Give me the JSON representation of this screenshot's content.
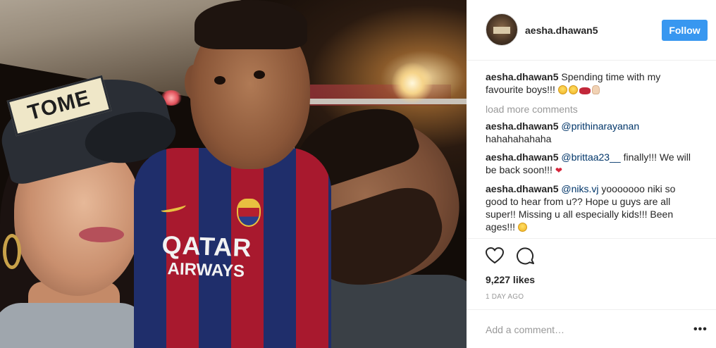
{
  "post": {
    "author": "aesha.dhawan5",
    "follow_label": "Follow",
    "caption": {
      "username": "aesha.dhawan5",
      "text": "Spending time with my favourite boys!!!",
      "emojis": [
        "smiling-face",
        "smiling-face",
        "kiss-mark",
        "hand"
      ]
    },
    "load_more_label": "load more comments",
    "comments": [
      {
        "username": "aesha.dhawan5",
        "mention": "@prithinarayanan",
        "text": "hahahahahaha"
      },
      {
        "username": "aesha.dhawan5",
        "mention": "@brittaa23__",
        "text": "finally!!! We will be back soon!!!",
        "emoji": "red-heart"
      },
      {
        "username": "aesha.dhawan5",
        "mention": "@niks.vj",
        "text": "yooooooo niki so good to hear from u?? Hope u guys are all super!! Missing u all especially kids!!! Been ages!!!",
        "emoji": "smiling-face"
      }
    ],
    "likes": "9,227 likes",
    "timestamp": "1 DAY AGO",
    "add_comment_placeholder": "Add a comment…",
    "more_label": "•••"
  },
  "photo": {
    "cap_text": "TOME",
    "shirt_sponsor_line1": "QATAR",
    "shirt_sponsor_line2": "AIRWAYS"
  },
  "colors": {
    "follow_button": "#3897f0",
    "mention": "#003569",
    "muted": "#999999",
    "text": "#262626"
  }
}
